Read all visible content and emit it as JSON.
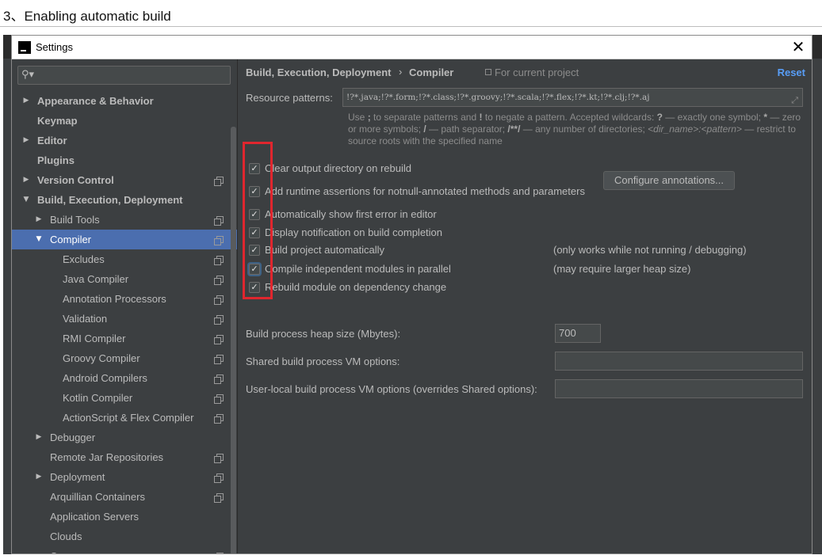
{
  "doc": {
    "caption": "3、Enabling automatic build"
  },
  "window": {
    "title": "Settings",
    "close_glyph": "✕",
    "icon_letters": "IJ"
  },
  "sidebar": {
    "search_placeholder": "",
    "search_icon": "search-icon",
    "items": [
      {
        "label": "Appearance & Behavior",
        "arrow": "right",
        "bold": true,
        "level": 0
      },
      {
        "label": "Keymap",
        "arrow": "",
        "bold": true,
        "level": 0
      },
      {
        "label": "Editor",
        "arrow": "right",
        "bold": true,
        "level": 0
      },
      {
        "label": "Plugins",
        "arrow": "",
        "bold": true,
        "level": 0
      },
      {
        "label": "Version Control",
        "arrow": "right",
        "bold": true,
        "level": 0,
        "project_icon": true
      },
      {
        "label": "Build, Execution, Deployment",
        "arrow": "down",
        "bold": true,
        "level": 0
      },
      {
        "label": "Build Tools",
        "arrow": "right",
        "level": 1,
        "project_icon": true
      },
      {
        "label": "Compiler",
        "arrow": "down",
        "level": 1,
        "project_icon": true,
        "selected": true
      },
      {
        "label": "Excludes",
        "arrow": "",
        "level": 2,
        "project_icon": true
      },
      {
        "label": "Java Compiler",
        "arrow": "",
        "level": 2,
        "project_icon": true
      },
      {
        "label": "Annotation Processors",
        "arrow": "",
        "level": 2,
        "project_icon": true
      },
      {
        "label": "Validation",
        "arrow": "",
        "level": 2,
        "project_icon": true
      },
      {
        "label": "RMI Compiler",
        "arrow": "",
        "level": 2,
        "project_icon": true
      },
      {
        "label": "Groovy Compiler",
        "arrow": "",
        "level": 2,
        "project_icon": true
      },
      {
        "label": "Android Compilers",
        "arrow": "",
        "level": 2,
        "project_icon": true
      },
      {
        "label": "Kotlin Compiler",
        "arrow": "",
        "level": 2,
        "project_icon": true
      },
      {
        "label": "ActionScript & Flex Compiler",
        "arrow": "",
        "level": 2,
        "project_icon": true
      },
      {
        "label": "Debugger",
        "arrow": "right",
        "level": 1
      },
      {
        "label": "Remote Jar Repositories",
        "arrow": "",
        "level": 1,
        "project_icon": true
      },
      {
        "label": "Deployment",
        "arrow": "right",
        "level": 1,
        "project_icon": true
      },
      {
        "label": "Arquillian Containers",
        "arrow": "",
        "level": 1,
        "project_icon": true
      },
      {
        "label": "Application Servers",
        "arrow": "",
        "level": 1
      },
      {
        "label": "Clouds",
        "arrow": "",
        "level": 1
      },
      {
        "label": "C...",
        "arrow": "",
        "level": 1,
        "project_icon": true
      }
    ]
  },
  "content": {
    "breadcrumb_parent": "Build, Execution, Deployment",
    "breadcrumb_sep": "›",
    "breadcrumb_current": "Compiler",
    "for_current_project": "For current project",
    "reset": "Reset",
    "resource_label": "Resource patterns:",
    "resource_value": "!?*.java;!?*.form;!?*.class;!?*.groovy;!?*.scala;!?*.flex;!?*.kt;!?*.clj;!?*.aj",
    "hint_parts": [
      "Use ",
      "; ",
      "to separate patterns and ",
      "! ",
      "to negate a pattern. Accepted wildcards: ",
      "? ",
      "— exactly one symbol; ",
      "* ",
      "— zero or more symbols; ",
      "/ ",
      "— path separator; ",
      "/**/ ",
      "— any number of directories; ",
      "<dir_name>:<pattern>",
      " — restrict to source roots with the specified name"
    ],
    "checkboxes": [
      {
        "label": "Clear output directory on rebuild",
        "checked": true,
        "note": ""
      },
      {
        "label": "Add runtime assertions for notnull-annotated methods and parameters",
        "checked": true,
        "note": ""
      },
      {
        "label": "Automatically show first error in editor",
        "checked": true,
        "note": ""
      },
      {
        "label": "Display notification on build completion",
        "checked": true,
        "note": ""
      },
      {
        "label": "Build project automatically",
        "checked": true,
        "note": "(only works while not running / debugging)"
      },
      {
        "label": "Compile independent modules in parallel",
        "checked": true,
        "note": "(may require larger heap size)",
        "focused": true
      },
      {
        "label": "Rebuild module on dependency change",
        "checked": true,
        "note": ""
      }
    ],
    "configure_button": "Configure annotations...",
    "heap_label": "Build process heap size (Mbytes):",
    "heap_value": "700",
    "shared_vm_label": "Shared build process VM options:",
    "shared_vm_value": "",
    "user_vm_label": "User-local build process VM options (overrides Shared options):",
    "user_vm_value": ""
  },
  "colors": {
    "bg": "#3c3f41",
    "text": "#bbbbbb",
    "selection": "#4b6eaf",
    "link": "#589df6",
    "annotation_box": "#e0262e"
  }
}
